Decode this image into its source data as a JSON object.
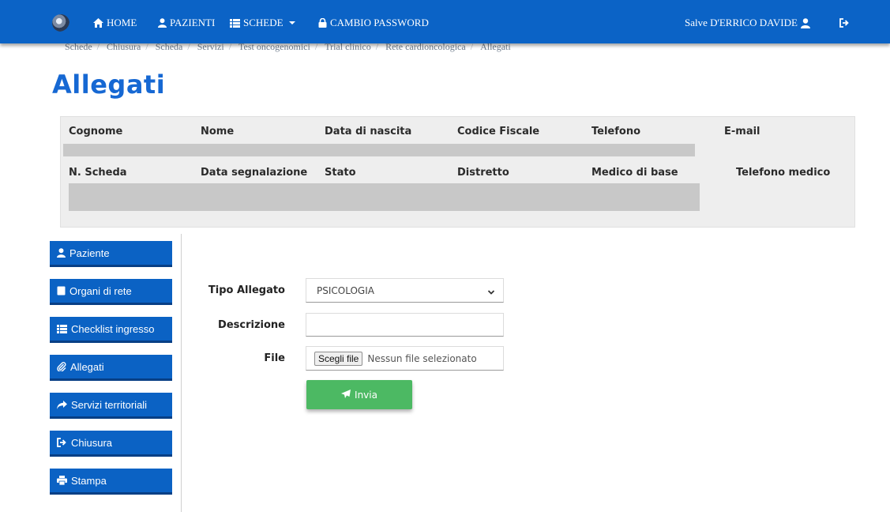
{
  "navbar": {
    "items": [
      {
        "label": "HOME",
        "icon": "home-icon"
      },
      {
        "label": "PAZIENTI",
        "icon": "user-icon"
      },
      {
        "label": "SCHEDE",
        "icon": "list-icon"
      },
      {
        "label": "CAMBIO PASSWORD",
        "icon": "lock-icon"
      }
    ],
    "greeting": "Salve D'ERRICO DAVIDE",
    "accent": "#0b63c6"
  },
  "breadcrumb": [
    "Schede",
    "Chiusura",
    "Scheda",
    "Servizi",
    "Test oncogenomici",
    "Trial clinico",
    "Rete cardioncologica",
    "Allegati"
  ],
  "page_title": "Allegati",
  "patient_table": {
    "row1_headers": [
      "Cognome",
      "Nome",
      "Data di nascita",
      "Codice Fiscale",
      "Telefono",
      "E-mail"
    ],
    "row2_headers": [
      "N. Scheda",
      "Data segnalazione",
      "Stato",
      "Distretto",
      "Medico di base",
      "Telefono medico"
    ]
  },
  "sidebar": {
    "items": [
      {
        "label": "Paziente",
        "icon": "user-icon"
      },
      {
        "label": "Organi di rete",
        "icon": "document-icon"
      },
      {
        "label": "Checklist ingresso",
        "icon": "list-icon"
      },
      {
        "label": "Allegati",
        "icon": "paperclip-icon"
      },
      {
        "label": "Servizi territoriali",
        "icon": "share-icon"
      },
      {
        "label": "Chiusura",
        "icon": "sign-out-icon"
      },
      {
        "label": "Stampa",
        "icon": "print-icon"
      }
    ]
  },
  "form": {
    "tipo_label": "Tipo Allegato",
    "tipo_value": "PSICOLOGIA",
    "descrizione_label": "Descrizione",
    "descrizione_value": "",
    "file_label": "File",
    "file_button": "Scegli file",
    "file_status": "Nessun file selezionato",
    "submit_label": "Invia",
    "submit_color": "#4cb963"
  }
}
